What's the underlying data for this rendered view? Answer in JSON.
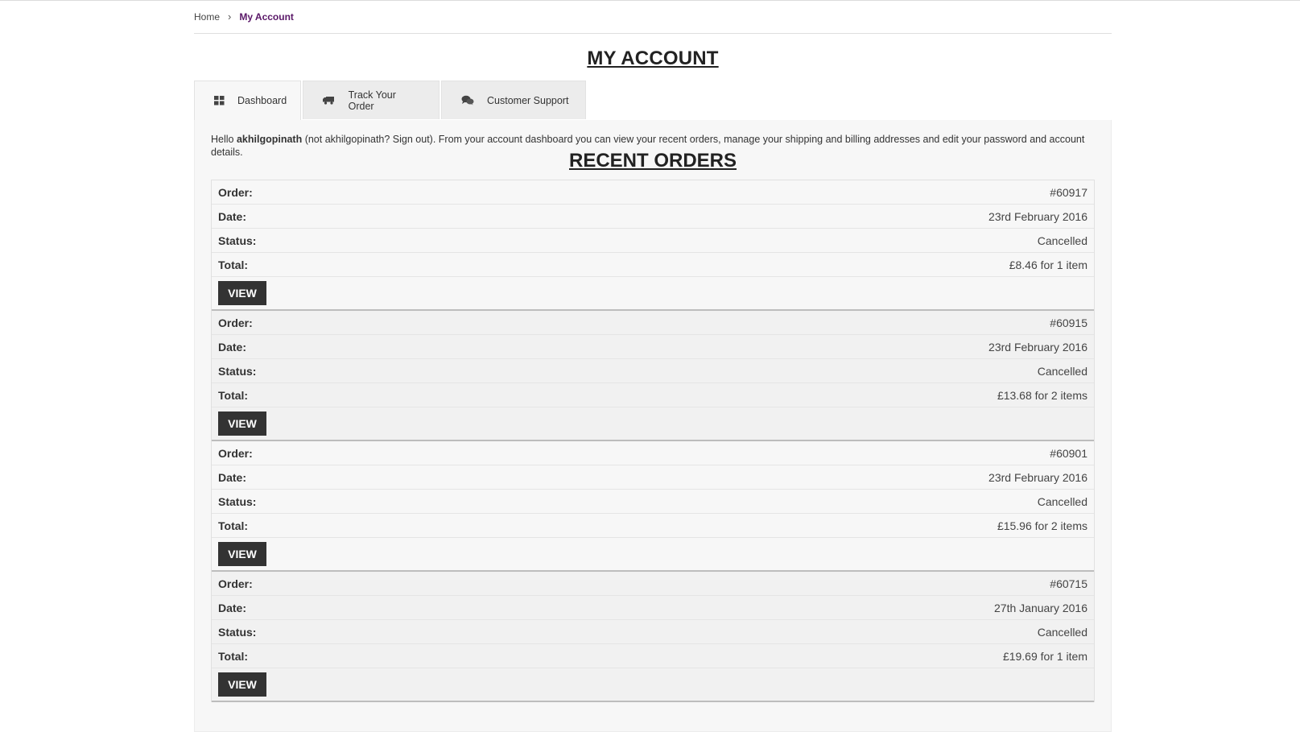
{
  "breadcrumb": {
    "home": "Home",
    "separator": "›",
    "current": "My Account"
  },
  "page_title": "MY ACCOUNT",
  "tabs": [
    {
      "label": "Dashboard",
      "icon": "dashboard-grid-icon",
      "active": true
    },
    {
      "label": "Track Your Order",
      "icon": "truck-icon",
      "active": false
    },
    {
      "label": "Customer Support",
      "icon": "chat-bubbles-icon",
      "active": false
    }
  ],
  "intro": {
    "hello": "Hello ",
    "username": "akhilgopinath",
    "rest": " (not akhilgopinath? Sign out). From your account dashboard you can view your recent orders, manage your shipping and billing addresses and edit your password and account details."
  },
  "recent_orders_title": "RECENT ORDERS",
  "labels": {
    "order": "Order:",
    "date": "Date:",
    "status": "Status:",
    "total": "Total:",
    "view": "VIEW"
  },
  "orders": [
    {
      "number": "#60917",
      "date": "23rd February 2016",
      "status": "Cancelled",
      "total": "£8.46 for 1 item"
    },
    {
      "number": "#60915",
      "date": "23rd February 2016",
      "status": "Cancelled",
      "total": "£13.68 for 2 items"
    },
    {
      "number": "#60901",
      "date": "23rd February 2016",
      "status": "Cancelled",
      "total": "£15.96 for 2 items"
    },
    {
      "number": "#60715",
      "date": "27th January 2016",
      "status": "Cancelled",
      "total": "£19.69 for 1 item"
    }
  ],
  "colors": {
    "breadcrumb_current": "#5a1868",
    "button_bg": "#333333"
  }
}
